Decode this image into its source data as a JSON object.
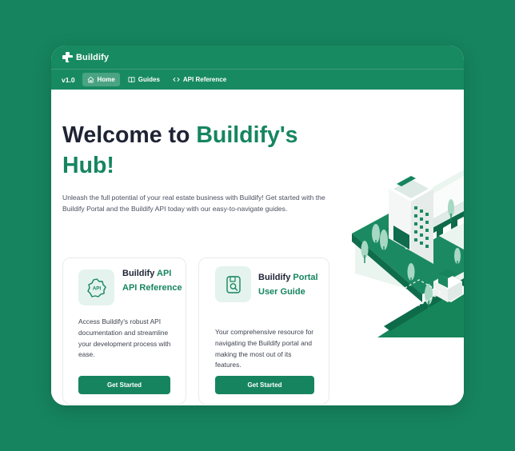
{
  "app": {
    "brand": "Buildify",
    "version": "v1.0"
  },
  "nav": {
    "items": [
      {
        "label": "Home",
        "icon": "home-icon",
        "active": true
      },
      {
        "label": "Guides",
        "icon": "book-icon",
        "active": false
      },
      {
        "label": "API Reference",
        "icon": "code-icon",
        "active": false
      }
    ]
  },
  "hero": {
    "title_prefix": "Welcome to ",
    "title_accent": "Buildify's Hub!",
    "intro": "Unleash the full potential of your real estate business with Buildify! Get started with the Buildify Portal and the Buildify API today with our easy-to-navigate guides."
  },
  "cards": [
    {
      "icon_text": "API",
      "title_plain": "Buildify",
      "title_accent_inline": "API",
      "title_accent_rest": "API Reference",
      "description": "Access Buildify's robust API documentation and streamline your development process with ease.",
      "button": "Get Started"
    },
    {
      "title_plain": "Buildify",
      "title_accent_inline": "Portal",
      "title_accent_rest": "User Guide",
      "description": "Your comprehensive resource for navigating the Buildify portal and making the most out of its features.",
      "button": "Get Started"
    }
  ],
  "colors": {
    "brand_green": "#16855f",
    "nav_green": "#188a62",
    "heading_dark": "#1e2434",
    "icon_tint": "#e4f3ed"
  }
}
